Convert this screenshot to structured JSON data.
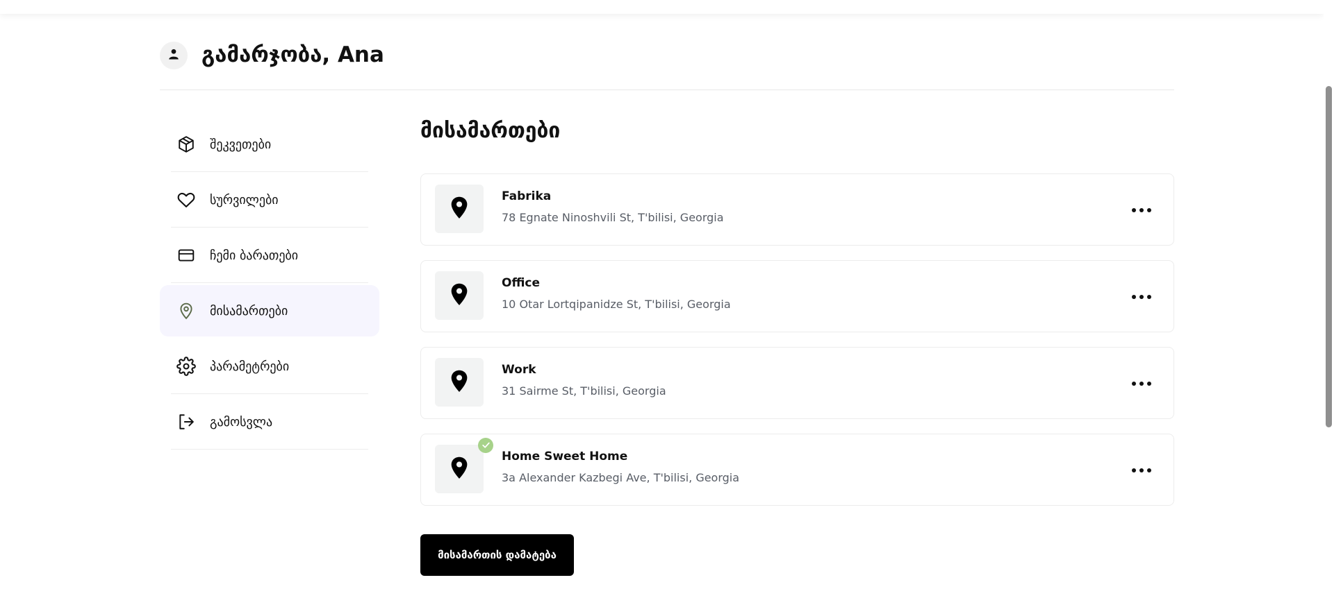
{
  "header": {
    "greeting": "გამარჯობა, Ana",
    "avatar_icon": "user-icon"
  },
  "sidebar": {
    "items": [
      {
        "label": "შეკვეთები",
        "icon": "box-icon",
        "active": false
      },
      {
        "label": "სურვილები",
        "icon": "heart-icon",
        "active": false
      },
      {
        "label": "ჩემი ბარათები",
        "icon": "credit-card-icon",
        "active": false
      },
      {
        "label": "მისამართები",
        "icon": "map-pin-icon",
        "active": true
      },
      {
        "label": "პარამეტრები",
        "icon": "gear-icon",
        "active": false
      },
      {
        "label": "გამოსვლა",
        "icon": "logout-icon",
        "active": false
      }
    ]
  },
  "main": {
    "title": "მისამართები",
    "addresses": [
      {
        "name": "Fabrika",
        "line": "78 Egnate Ninoshvili St, T'bilisi, Georgia",
        "is_default": false
      },
      {
        "name": "Office",
        "line": "10 Otar Lortqipanidze St, T'bilisi, Georgia",
        "is_default": false
      },
      {
        "name": "Work",
        "line": "31 Sairme St, T'bilisi, Georgia",
        "is_default": false
      },
      {
        "name": "Home Sweet Home",
        "line": "3a Alexander Kazbegi Ave, T'bilisi, Georgia",
        "is_default": true
      }
    ],
    "add_button_label": "მისამართის დამატება"
  },
  "colors": {
    "accent": "#000000",
    "active_sidebar_bg": "#f6f5fe",
    "active_icon": "#5c6b4a",
    "default_badge": "#a7d28a",
    "muted_text": "#585d66"
  }
}
